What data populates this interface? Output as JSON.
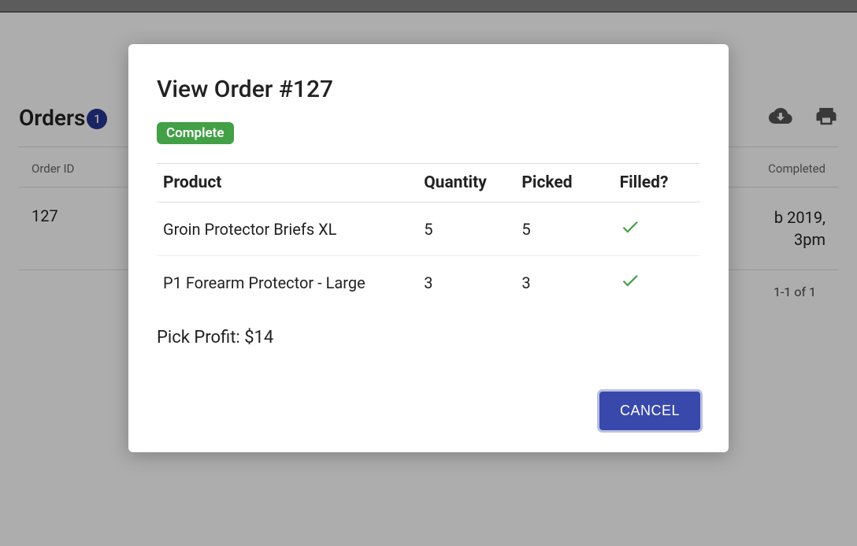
{
  "background": {
    "page_title": "Orders",
    "badge_count": "1",
    "table": {
      "header_order_id": "Order ID",
      "header_completed": "Completed",
      "row_order_id": "127",
      "row_completed_line1": "b 2019,",
      "row_completed_line2": "3pm",
      "footer_range": "1-1 of 1"
    }
  },
  "modal": {
    "title": "View Order #127",
    "status": "Complete",
    "columns": {
      "product": "Product",
      "quantity": "Quantity",
      "picked": "Picked",
      "filled": "Filled?"
    },
    "rows": [
      {
        "product": "Groin Protector Briefs XL",
        "quantity": "5",
        "picked": "5",
        "filled": true
      },
      {
        "product": "P1 Forearm Protector - Large",
        "quantity": "3",
        "picked": "3",
        "filled": true
      }
    ],
    "profit_label": "Pick Profit: $14",
    "cancel_label": "CANCEL"
  }
}
